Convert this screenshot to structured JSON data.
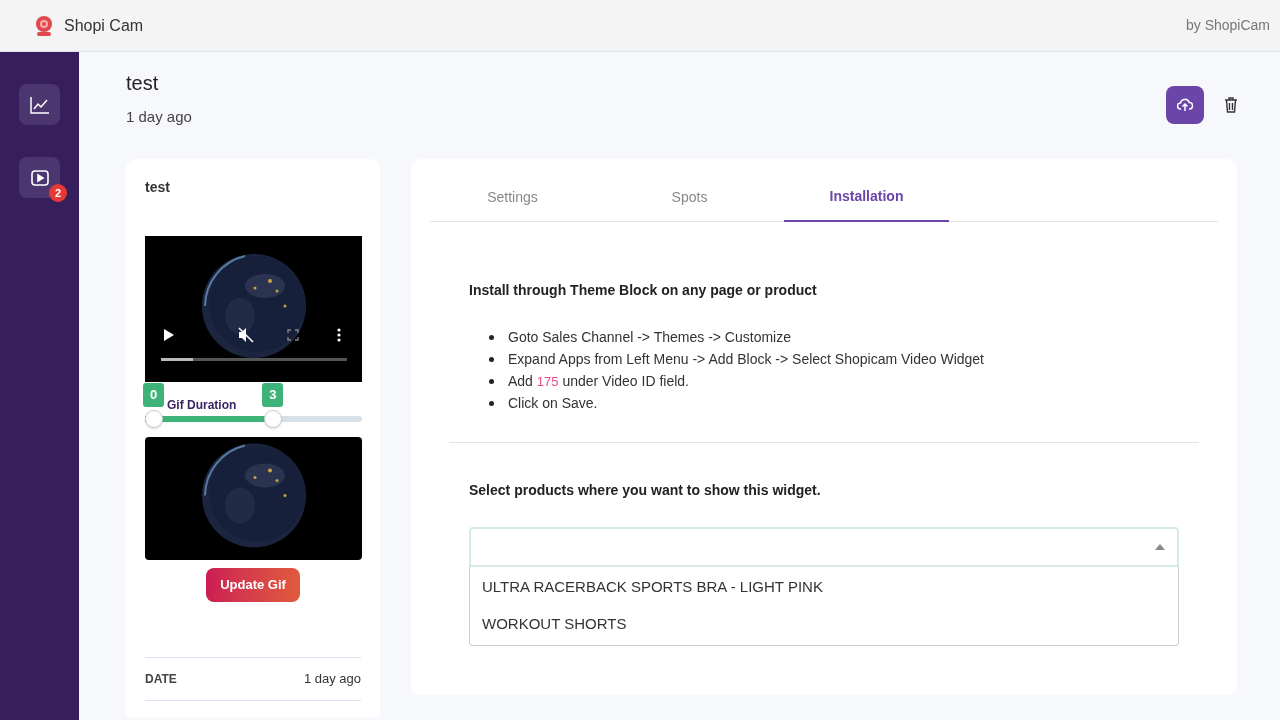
{
  "header": {
    "app_name": "Shopi Cam",
    "byline": "by ShopiCam"
  },
  "sidebar": {
    "items": [
      {
        "kind": "chart",
        "selected": false
      },
      {
        "kind": "video",
        "selected": false,
        "badge": "2"
      }
    ]
  },
  "page": {
    "title": "test",
    "subtitle": "1 day ago"
  },
  "video_card": {
    "title": "test",
    "video_progress": {
      "level": 0.17
    },
    "slider_label": "Gif Duration",
    "thumbs": [
      {
        "label": "0",
        "level": 0
      },
      {
        "label": "3",
        "level": 0.6
      }
    ],
    "button": "Update Gif",
    "details": [
      {
        "label": "DATE",
        "value": "1 day ago"
      }
    ]
  },
  "tabs": [
    {
      "label": "Settings",
      "selected": false
    },
    {
      "label": "Spots",
      "selected": false
    },
    {
      "label": "Installation",
      "selected": true
    }
  ],
  "installation": {
    "heading": "Install through Theme Block on any page or product",
    "steps": [
      "Goto Sales Channel -> Themes -> Customize",
      "Expand Apps from Left Menu -> Add Block -> Select Shopicam Video Widget",
      "Add *175* under Video ID field.",
      "Click on Save."
    ]
  },
  "products": {
    "heading": "Select products where you want to show this widget.",
    "options": [
      "ULTRA RACERBACK SPORTS BRA - LIGHT PINK",
      "WORKOUT SHORTS"
    ]
  }
}
